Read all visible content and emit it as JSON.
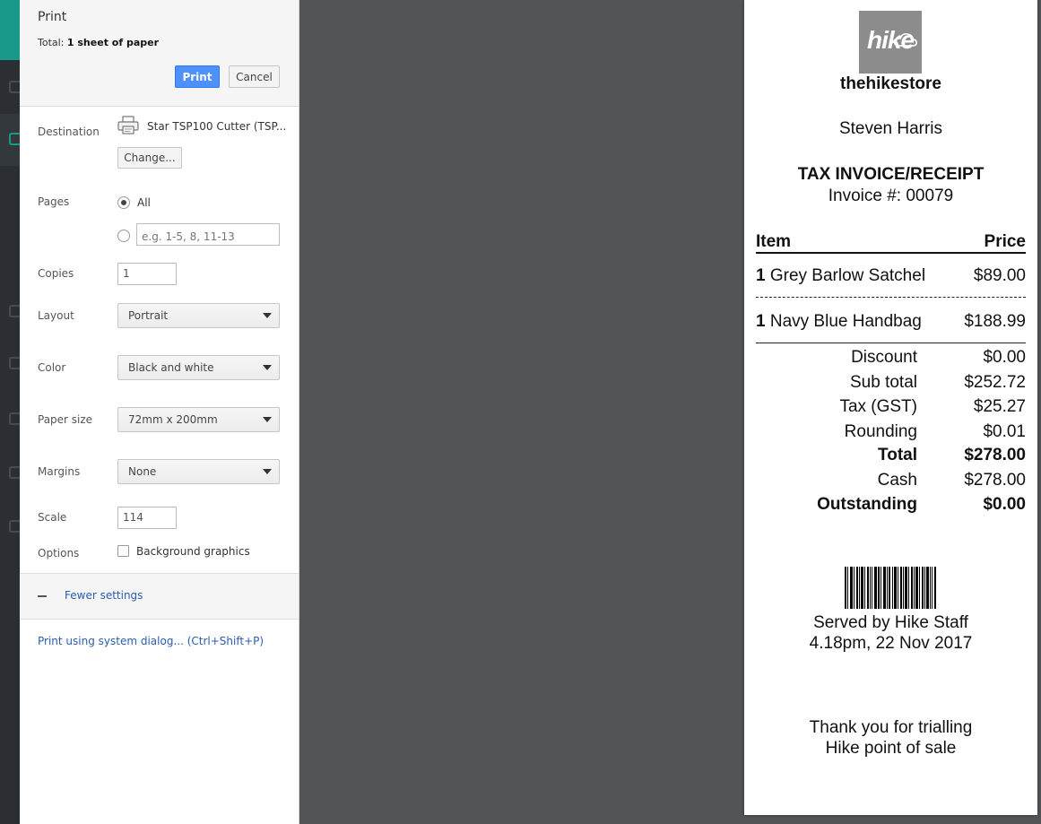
{
  "dialog": {
    "title": "Print",
    "total_label": "Total:",
    "total_value": "1 sheet of paper",
    "print_label": "Print",
    "cancel_label": "Cancel"
  },
  "destination": {
    "label": "Destination",
    "printer": "Star TSP100 Cutter (TSP...",
    "change_label": "Change..."
  },
  "pages": {
    "label": "Pages",
    "all_label": "All",
    "range_placeholder": "e.g. 1-5, 8, 11-13"
  },
  "copies": {
    "label": "Copies",
    "value": "1"
  },
  "layout": {
    "label": "Layout",
    "value": "Portrait"
  },
  "color": {
    "label": "Color",
    "value": "Black and white"
  },
  "paper_size": {
    "label": "Paper size",
    "value": "72mm x 200mm"
  },
  "margins": {
    "label": "Margins",
    "value": "None"
  },
  "scale": {
    "label": "Scale",
    "value": "114"
  },
  "options": {
    "label": "Options",
    "background_graphics": "Background graphics"
  },
  "fewer_settings": "Fewer settings",
  "system_dialog": "Print using system dialog... (Ctrl+Shift+P)",
  "receipt": {
    "logo_text": "hike",
    "store": "thehikestore",
    "customer": "Steven Harris",
    "doc_title": "TAX INVOICE/RECEIPT",
    "invoice": "Invoice #: 00079",
    "col_item": "Item",
    "col_price": "Price",
    "items": [
      {
        "qty": "1",
        "name": "Grey Barlow Satchel",
        "price": "$89.00"
      },
      {
        "qty": "1",
        "name": "Navy Blue Handbag",
        "price": "$188.99"
      }
    ],
    "summary": [
      {
        "label": "Discount",
        "value": "$0.00"
      },
      {
        "label": "Sub total",
        "value": "$252.72"
      },
      {
        "label": "Tax (GST)",
        "value": "$25.27"
      },
      {
        "label": "Rounding",
        "value": "$0.01"
      },
      {
        "label": "Total",
        "value": "$278.00"
      },
      {
        "label": "Cash",
        "value": "$278.00"
      },
      {
        "label": "Outstanding",
        "value": "$0.00"
      }
    ],
    "served_by": "Served by Hike Staff",
    "datetime": "4.18pm, 22 Nov 2017",
    "thanks_line1": "Thank you for trialling",
    "thanks_line2": "Hike point of sale"
  },
  "icons": {
    "printer": "printer-icon",
    "dropdown": "chevron-down-icon",
    "collapse": "minus-icon"
  },
  "colors": {
    "print_button": "#4d90fe",
    "link": "#2a5db0",
    "app_teal": "#19998a",
    "preview_background": "#515558",
    "logo_background": "#8c8c8c"
  }
}
